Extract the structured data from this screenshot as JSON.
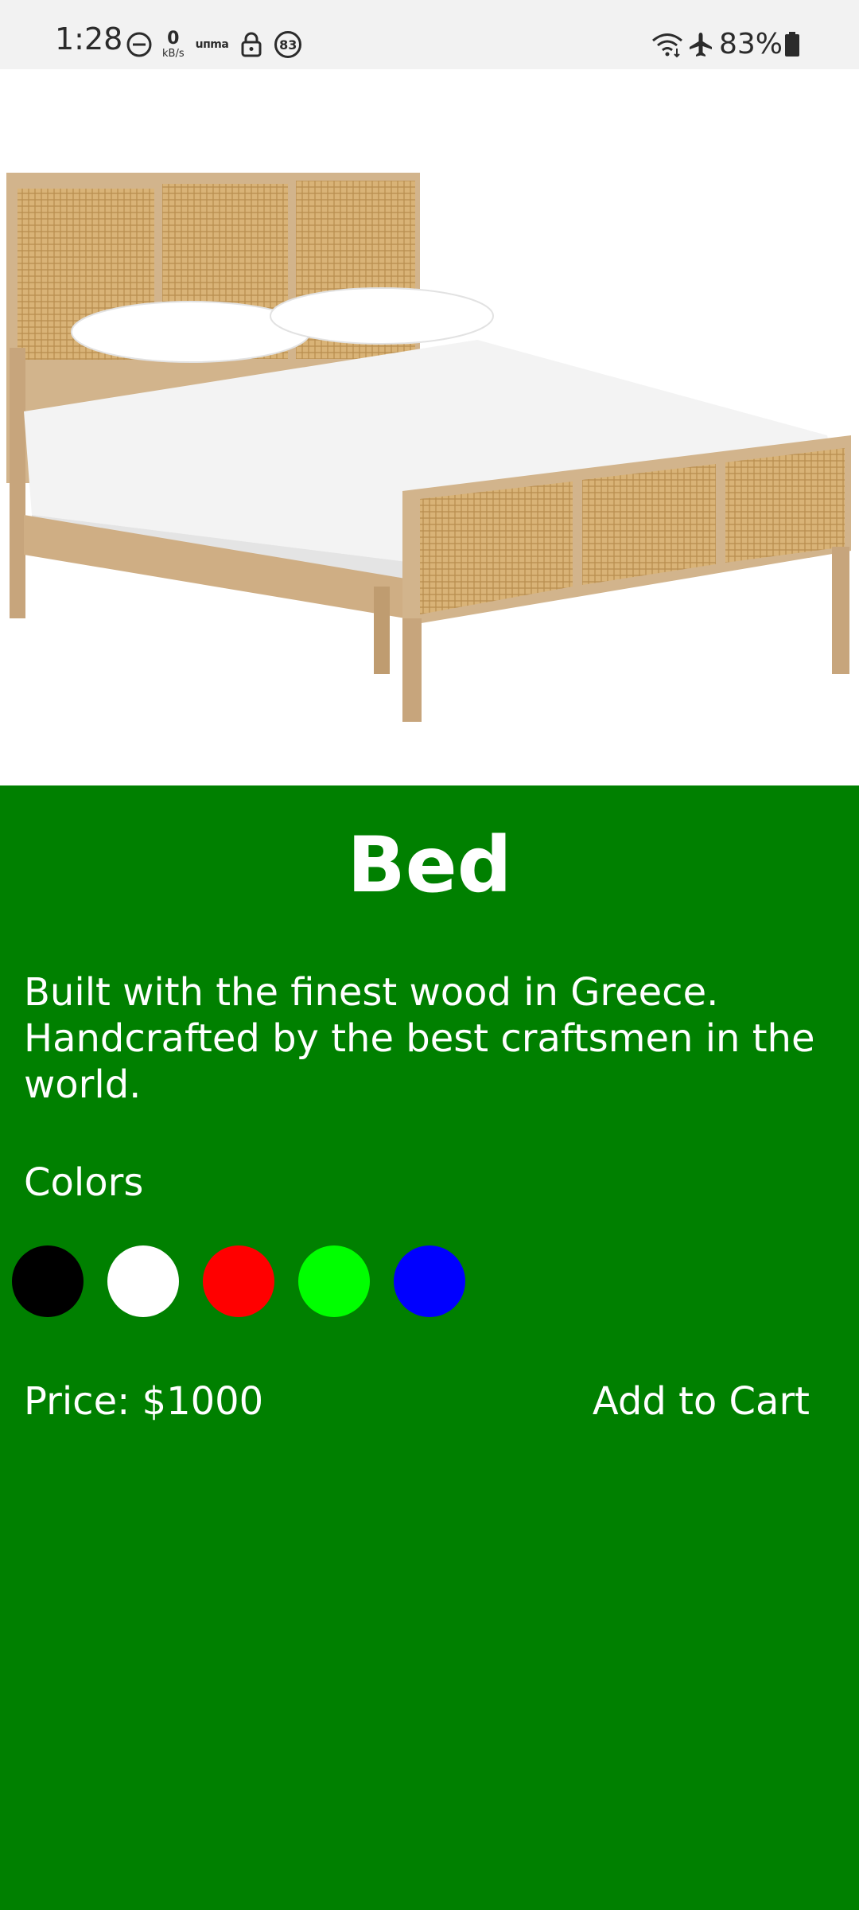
{
  "status_bar": {
    "time": "1:28",
    "net_speed_value": "0",
    "net_speed_unit": "kB/s",
    "carrier": "uпmа",
    "notification_count": "83",
    "battery_percent": "83%",
    "icons": [
      "do-not-disturb-icon",
      "lock-icon",
      "wifi-icon",
      "airplane-icon",
      "battery-icon"
    ]
  },
  "product": {
    "image_description_icon": "bed-image",
    "title": "Bed",
    "description": "Built with the finest wood in Greece. Handcrafted by the best craftsmen in the world.",
    "colors_label": "Colors",
    "colors": [
      "#000000",
      "#ffffff",
      "#ff0000",
      "#00ff00",
      "#0000ff"
    ],
    "price_label": "Price: $1000",
    "add_to_cart_label": "Add to Cart"
  },
  "theme": {
    "panel_background": "#008000",
    "text_color": "#ffffff"
  }
}
